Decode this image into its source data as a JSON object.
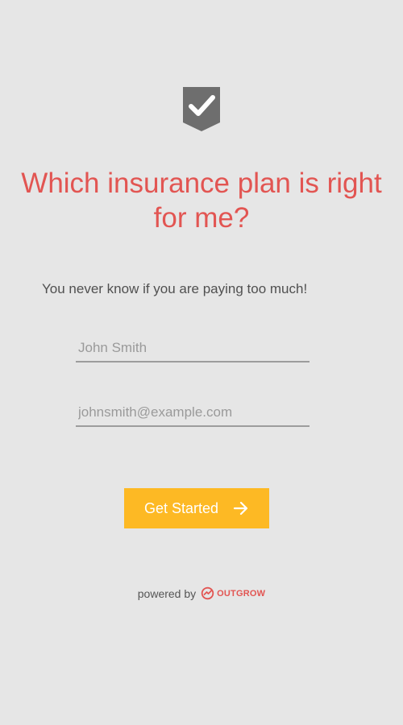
{
  "header": {
    "logo_icon": "shield-check-icon",
    "title": "Which insurance plan is right for me?",
    "subtitle": "You never know if you are paying too much!"
  },
  "form": {
    "name_placeholder": "John Smith",
    "email_placeholder": "johnsmith@example.com",
    "submit_label": "Get Started",
    "submit_icon": "arrow-right-icon"
  },
  "footer": {
    "powered_label": "powered by",
    "brand_name": "OUTGROW"
  },
  "colors": {
    "background": "#e6e6e6",
    "title": "#e25552",
    "button": "#fdb924",
    "button_text": "#ffffff",
    "logo": "#6e6e6e"
  }
}
